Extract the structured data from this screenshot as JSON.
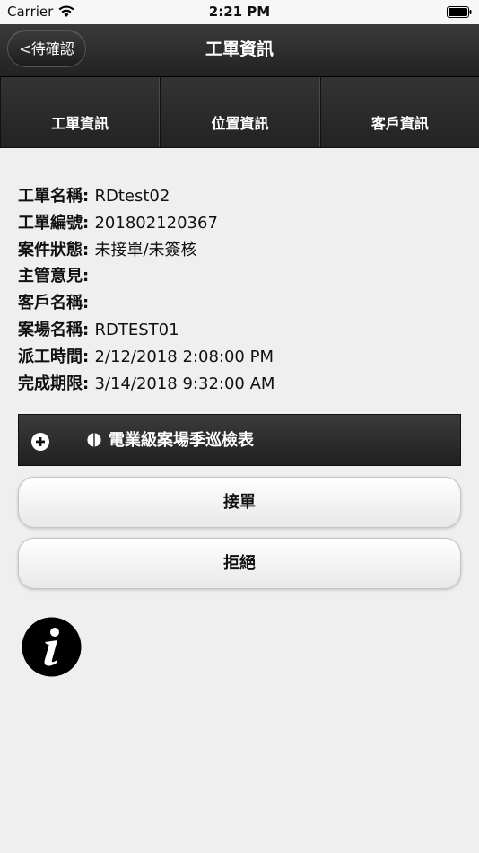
{
  "status_bar": {
    "carrier": "Carrier",
    "time": "2:21 PM",
    "icons": [
      "wifi-icon",
      "battery-icon"
    ]
  },
  "nav": {
    "back_label": "<待確認",
    "title": "工單資訊"
  },
  "tabs": [
    {
      "label": "工單資訊"
    },
    {
      "label": "位置資訊"
    },
    {
      "label": "客戶資訊"
    }
  ],
  "details": [
    {
      "label": "工單名稱: ",
      "value": "RDtest02"
    },
    {
      "label": "工單編號: ",
      "value": "201802120367"
    },
    {
      "label": "案件狀態: ",
      "value": "未接單/未簽核"
    },
    {
      "label": "主管意見: ",
      "value": ""
    },
    {
      "label": "客戶名稱: ",
      "value": ""
    },
    {
      "label": "案場名稱: ",
      "value": "RDTEST01"
    },
    {
      "label": "派工時間: ",
      "value": "2/12/2018 2:08:00 PM"
    },
    {
      "label": "完成期限: ",
      "value": "3/14/2018 9:32:00 AM"
    }
  ],
  "checklist": {
    "label": "電業級案場季巡檢表",
    "icons": [
      "plus-icon",
      "half-circle-icon"
    ]
  },
  "actions": {
    "accept_label": "接單",
    "reject_label": "拒絕"
  },
  "colors": {
    "header_dark": "#262626",
    "background": "#efefef",
    "button_light": "#ffffff"
  }
}
